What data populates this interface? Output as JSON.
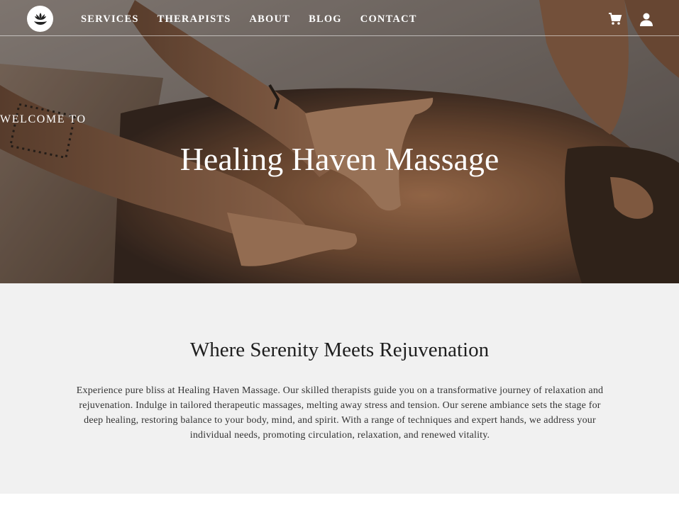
{
  "nav": {
    "logo_icon": "lotus-hands-icon",
    "links": [
      "SERVICES",
      "THERAPISTS",
      "ABOUT",
      "BLOG",
      "CONTACT"
    ],
    "cart_icon": "cart-icon",
    "account_icon": "user-icon"
  },
  "hero": {
    "eyebrow": "WELCOME TO",
    "title": "Healing Haven Massage",
    "image": "massage-back-photo"
  },
  "intro": {
    "heading": "Where Serenity Meets Rejuvenation",
    "body": "Experience pure bliss at Healing Haven Massage. Our skilled therapists guide you on a transformative journey of relaxation and rejuvenation. Indulge in tailored therapeutic massages, melting away stress and tension. Our serene ambiance sets the stage for deep healing, restoring balance to your body, mind, and spirit. With a range of techniques and expert hands, we address your individual needs, promoting circulation, relaxation, and renewed vitality."
  },
  "colors": {
    "intro_background": "#f1f1f1",
    "text_light": "#ffffff",
    "heading_dark": "#1e1e1e"
  }
}
